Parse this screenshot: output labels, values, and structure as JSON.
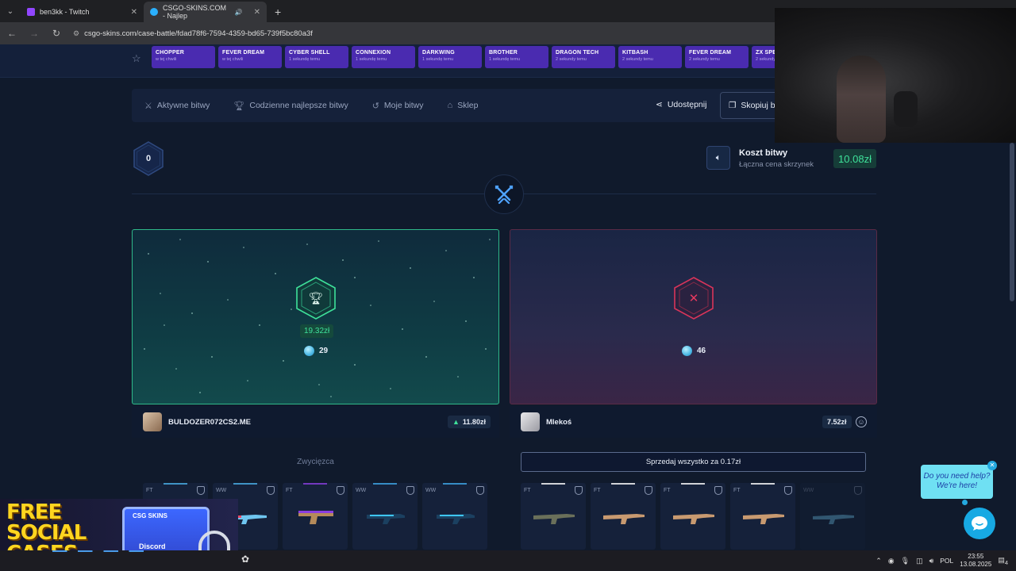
{
  "browser": {
    "tabs": [
      {
        "title": "ben3kk - Twitch",
        "active": false,
        "favicon_color": "#9146ff"
      },
      {
        "title": "CSGO-SKINS.COM - Najlep",
        "active": true,
        "favicon_color": "#2ab0ff"
      }
    ],
    "url": "csgo-skins.com/case-battle/fdad78f6-7594-4359-bd65-739f5bc80a3f",
    "new_tab": "+",
    "menu_icon": "chevron-down-icon"
  },
  "live_drops": [
    {
      "name": "CHOPPER",
      "time": "w tej chwili"
    },
    {
      "name": "FEVER DREAM",
      "time": "w tej chwili"
    },
    {
      "name": "CYBER SHELL",
      "time": "1 sekundę temu"
    },
    {
      "name": "CONNEXION",
      "time": "1 sekundę temu"
    },
    {
      "name": "DARKWING",
      "time": "1 sekundę temu"
    },
    {
      "name": "BROTHER",
      "time": "1 sekundę temu"
    },
    {
      "name": "DRAGON TECH",
      "time": "2 sekundy temu"
    },
    {
      "name": "KITBASH",
      "time": "2 sekundy temu"
    },
    {
      "name": "FEVER DREAM",
      "time": "2 sekundy temu"
    },
    {
      "name": "ZX SPE",
      "time": "2 sekundy temu"
    }
  ],
  "subnav": {
    "items": [
      {
        "label": "Aktywne bitwy",
        "icon": "swords-icon"
      },
      {
        "label": "Codzienne najlepsze bitwy",
        "icon": "trophy-icon"
      },
      {
        "label": "Moje bitwy",
        "icon": "history-icon"
      },
      {
        "label": "Sklep",
        "icon": "basket-icon"
      }
    ],
    "share": "Udostępnij",
    "copy": "Skopiuj b"
  },
  "round": "0",
  "cost": {
    "title": "Koszt bitwy",
    "subtitle": "Łączna cena skrzynek",
    "value": "10.08zł"
  },
  "players": [
    {
      "name": "BULDOZER072CS2.ME",
      "status": "winner",
      "prize": "19.32zł",
      "coins": "29",
      "value": "11.80zł",
      "label": "Zwycięzca"
    },
    {
      "name": "Mlekoś",
      "status": "loser",
      "coins": "46",
      "value": "7.52zł",
      "sell": "Sprzedaj wszystko za 0.17zł"
    }
  ],
  "left_items": [
    {
      "cond": "FT",
      "color": "#4ab0e8"
    },
    {
      "cond": "WW",
      "color": "#4ab0e8"
    },
    {
      "cond": "FT",
      "color": "#8a3ee0"
    },
    {
      "cond": "WW",
      "color": "#3ea8e8"
    },
    {
      "cond": "WW",
      "color": "#3ea8e8"
    }
  ],
  "right_items": [
    {
      "cond": "FT",
      "color": "#7a8a70"
    },
    {
      "cond": "FT",
      "color": "#c89a70"
    },
    {
      "cond": "FT",
      "color": "#c89a70"
    },
    {
      "cond": "FT",
      "color": "#c89a70"
    },
    {
      "cond": "WW",
      "color": "#4ab0e8"
    }
  ],
  "promo": {
    "text": "FREE SOCIAL CASES",
    "box_top": "CSG SKINS",
    "box_label": "Discord"
  },
  "help": {
    "text": "Do you need help? We're here!"
  },
  "taskbar": {
    "lang": "POL",
    "time": "23:55",
    "date": "13.08.2025",
    "notif": "4"
  },
  "colors": {
    "accent_green": "#3ee19a",
    "win_border": "#2fb88a",
    "lose_border": "#5a2a45",
    "drop_purple": "#4a2bb0"
  }
}
